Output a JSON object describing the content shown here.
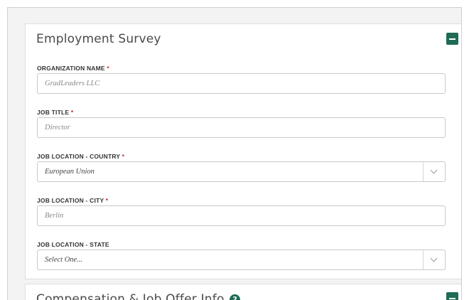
{
  "survey": {
    "title": "Employment Survey",
    "collapse_icon": "minus-square-icon",
    "fields": {
      "org": {
        "label": "ORGANIZATION NAME",
        "required": "*",
        "value": "GradLeaders LLC"
      },
      "job_title": {
        "label": "JOB TITLE",
        "required": "*",
        "value": "Director"
      },
      "country": {
        "label": "JOB LOCATION - COUNTRY",
        "required": "*",
        "value": "European Union"
      },
      "city": {
        "label": "JOB LOCATION - CITY",
        "required": "*",
        "value": "Berlin"
      },
      "state": {
        "label": "JOB LOCATION - STATE",
        "value": "Select One..."
      }
    }
  },
  "compensation": {
    "title": "Compensation & Job Offer Info",
    "help_icon": "question-circle-icon",
    "help_glyph": "?"
  },
  "colors": {
    "accent": "#1f6b55",
    "required": "#c62828"
  }
}
